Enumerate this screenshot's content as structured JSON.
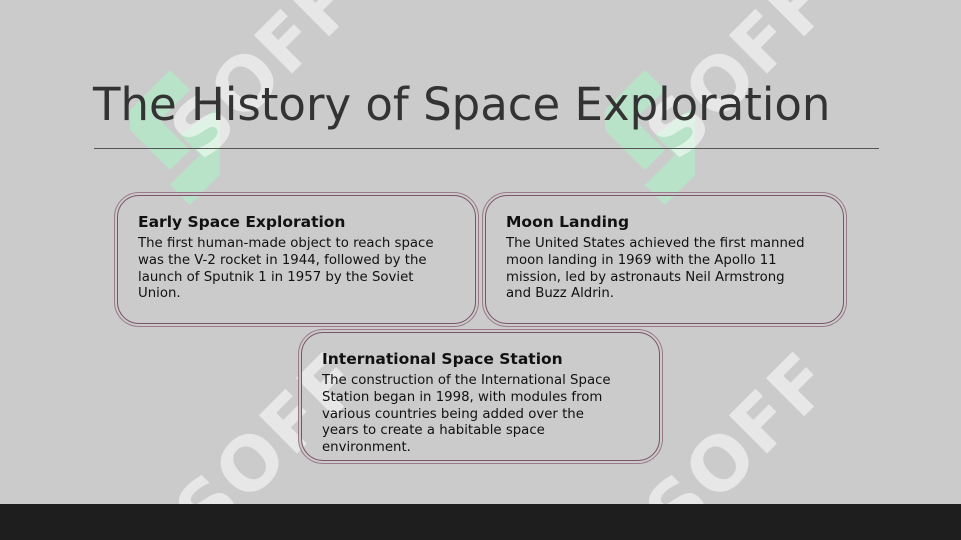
{
  "slide": {
    "title": "The History of Space Exploration",
    "watermark_text": "SOFF"
  },
  "cards": [
    {
      "heading": "Early Space Exploration",
      "lines": [
        "The first human-made object to reach space",
        "was the V-2 rocket in 1944, followed by the",
        "launch of Sputnik 1 in 1957 by the Soviet",
        "Union."
      ]
    },
    {
      "heading": "Moon Landing",
      "lines": [
        "The United States achieved the first manned",
        "moon landing in 1969 with the Apollo 11",
        "mission, led by astronauts Neil Armstrong",
        "and Buzz Aldrin."
      ]
    },
    {
      "heading": "International Space Station",
      "lines": [
        "The construction of the International Space",
        "Station began in 1998, with modules from",
        "various countries being added over the",
        "years to create a habitable space",
        "environment."
      ]
    }
  ],
  "colors": {
    "background": "#cbcbcb",
    "title": "#333333",
    "card_border": "#7a5468",
    "footer": "#1e1e1e",
    "watermark_mark": "#a8e6c0"
  }
}
